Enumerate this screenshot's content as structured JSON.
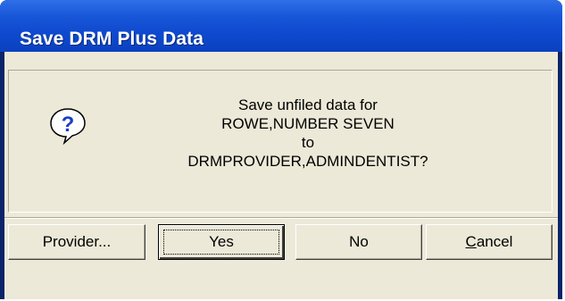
{
  "window": {
    "title": "Save DRM Plus Data"
  },
  "message": {
    "icon": "question-icon",
    "lines": [
      "Save unfiled data for",
      "ROWE,NUMBER SEVEN",
      "to",
      "DRMPROVIDER,ADMINDENTIST?"
    ]
  },
  "buttons": {
    "provider_label": "Provider...",
    "yes_label": "Yes",
    "no_label": "No",
    "cancel_first": "C",
    "cancel_rest": "ancel"
  },
  "colors": {
    "titlebar": "#0a41c0",
    "dialog_bg": "#ece9d8",
    "icon_blue": "#1a3dc9"
  }
}
